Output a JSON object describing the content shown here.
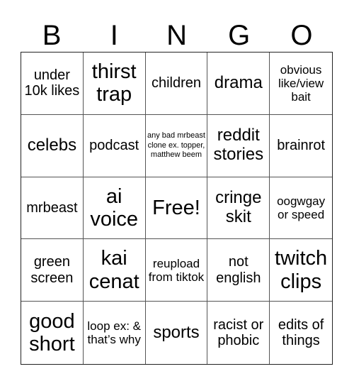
{
  "header": {
    "letters": [
      "B",
      "I",
      "N",
      "G",
      "O"
    ]
  },
  "cells": [
    {
      "text": "under 10k likes",
      "size": "s-md"
    },
    {
      "text": "thirst trap",
      "size": "s-xl"
    },
    {
      "text": "children",
      "size": "s-md"
    },
    {
      "text": "drama",
      "size": "s-lg"
    },
    {
      "text": "obvious like/view bait",
      "size": "s-sm"
    },
    {
      "text": "celebs",
      "size": "s-lg"
    },
    {
      "text": "podcast",
      "size": "s-md"
    },
    {
      "text": "any bad mrbeast clone ex. topper, matthew beem",
      "size": "s-xs"
    },
    {
      "text": "reddit stories",
      "size": "s-lg"
    },
    {
      "text": "brainrot",
      "size": "s-md"
    },
    {
      "text": "mrbeast",
      "size": "s-md"
    },
    {
      "text": "ai voice",
      "size": "s-xl"
    },
    {
      "text": "Free!",
      "size": "s-xl"
    },
    {
      "text": "cringe skit",
      "size": "s-lg"
    },
    {
      "text": "oogwgay or speed",
      "size": "s-sm"
    },
    {
      "text": "green screen",
      "size": "s-md"
    },
    {
      "text": "kai cenat",
      "size": "s-xl"
    },
    {
      "text": "reupload from tiktok",
      "size": "s-sm"
    },
    {
      "text": "not english",
      "size": "s-md"
    },
    {
      "text": "twitch clips",
      "size": "s-xl"
    },
    {
      "text": "good short",
      "size": "s-xl"
    },
    {
      "text": "loop ex: & that’s why",
      "size": "s-sm"
    },
    {
      "text": "sports",
      "size": "s-lg"
    },
    {
      "text": "racist or phobic",
      "size": "s-md"
    },
    {
      "text": "edits of things",
      "size": "s-md"
    }
  ]
}
